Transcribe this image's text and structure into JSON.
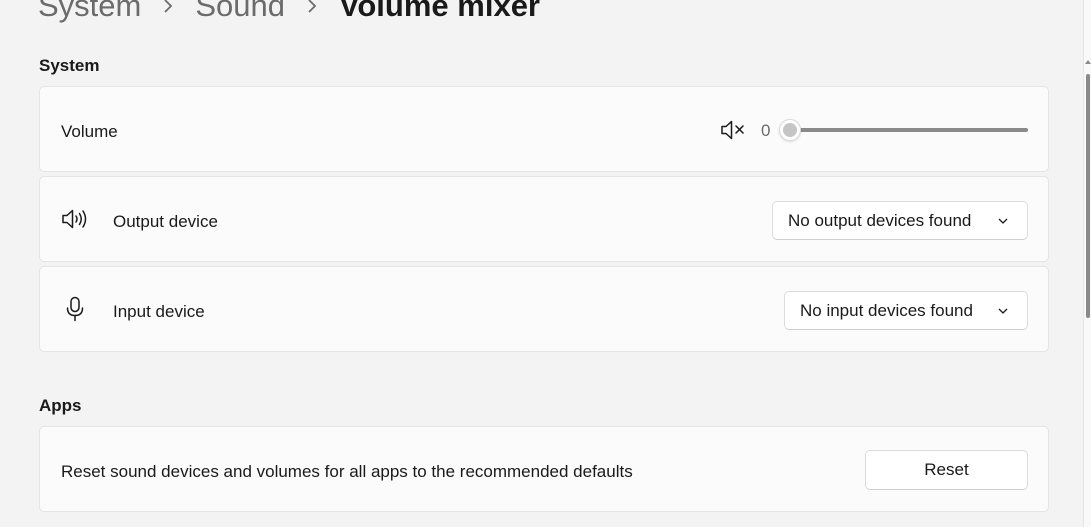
{
  "breadcrumb": {
    "items": [
      "System",
      "Sound"
    ],
    "current": "Volume mixer"
  },
  "system_section": {
    "title": "System",
    "volume": {
      "label": "Volume",
      "value": "0",
      "level_percent": 0,
      "icon": "speaker-muted-icon"
    },
    "output_device": {
      "label": "Output device",
      "icon": "speaker-icon",
      "selected": "No output devices found"
    },
    "input_device": {
      "label": "Input device",
      "icon": "microphone-icon",
      "selected": "No input devices found"
    }
  },
  "apps_section": {
    "title": "Apps",
    "reset_text": "Reset sound devices and volumes for all apps to the recommended defaults",
    "reset_button": "Reset"
  },
  "colors": {
    "background": "#f3f3f3",
    "card": "#fbfbfb",
    "text": "#1a1a1a",
    "muted_text": "#6b6b6b"
  }
}
